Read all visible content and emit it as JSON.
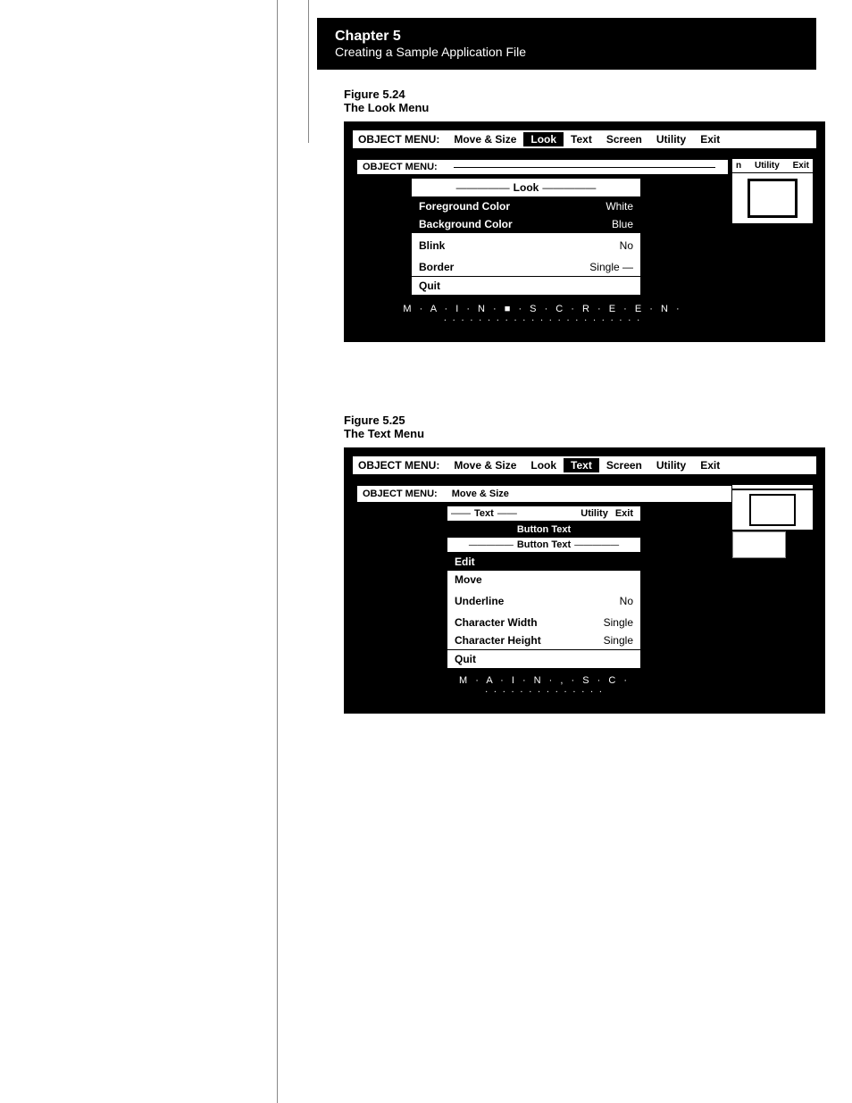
{
  "chapter": {
    "number": "Chapter 5",
    "subtitle": "Creating a Sample Application File"
  },
  "figure524": {
    "label": "Figure 5.24",
    "title": "The Look Menu",
    "menubar": {
      "label": "OBJECT MENU:",
      "items": [
        "Move & Size",
        "Look",
        "Text",
        "Screen",
        "Utility",
        "Exit"
      ]
    },
    "inner_menubar": {
      "label": "OBJECT MENU:",
      "items": [
        "n",
        "Utility",
        "Exit"
      ]
    },
    "look_dropdown": {
      "title": "Look",
      "rows": [
        {
          "label": "Foreground Color",
          "value": "White",
          "selected": true
        },
        {
          "label": "Background Color",
          "value": "Blue",
          "selected": true
        },
        {
          "label": "Blink",
          "value": "No"
        },
        {
          "label": "Border",
          "value": "Single —"
        },
        {
          "label": "Quit",
          "value": ""
        }
      ]
    },
    "main_screen_text": "M · A · I · N · ■ · S · C · R · E · E · N ·",
    "dots": "· · · · · · · · · · · · · · · · · · · · · · ·"
  },
  "figure525": {
    "label": "Figure 5.25",
    "title": "The Text Menu",
    "menubar": {
      "label": "OBJECT MENU:",
      "items": [
        "Move & Size",
        "Look",
        "Text",
        "Screen",
        "Utility",
        "Exit"
      ]
    },
    "inner_menubar": {
      "label": "OBJECT MENU:",
      "items": [
        "Move & Size"
      ]
    },
    "text_dropdown": {
      "top_label": "Text",
      "button_text_bar": "Button Text",
      "button_text_sub": "Button Text",
      "rows": [
        {
          "label": "Edit",
          "value": "",
          "selected": true
        },
        {
          "label": "Move",
          "value": ""
        },
        {
          "label": "Underline",
          "value": "No"
        },
        {
          "label": "Character Width",
          "value": "Single"
        },
        {
          "label": "Character Height",
          "value": "Single"
        },
        {
          "label": "Quit",
          "value": ""
        }
      ]
    },
    "main_screen_text": "M · A · I · N · , · S · C ·",
    "dots": "· · · · · · · · · · · · · ·"
  }
}
